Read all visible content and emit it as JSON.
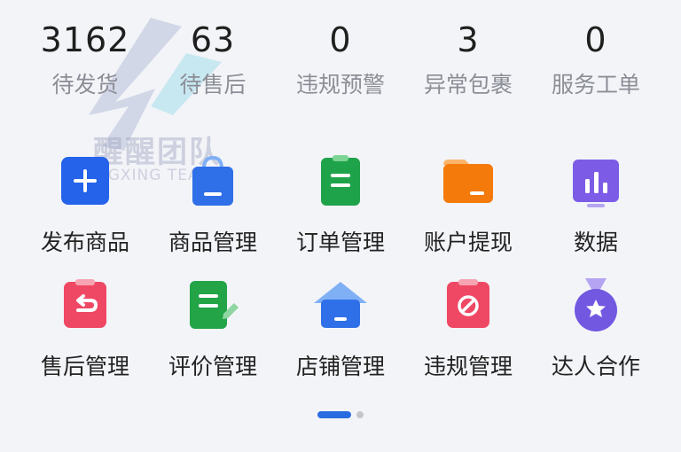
{
  "stats": [
    {
      "value": "3162",
      "label": "待发货"
    },
    {
      "value": "63",
      "label": "待售后"
    },
    {
      "value": "0",
      "label": "违规预警"
    },
    {
      "value": "3",
      "label": "异常包裹"
    },
    {
      "value": "0",
      "label": "服务工单"
    }
  ],
  "watermark": {
    "title": "醒醒团队",
    "subtitle": "NGXING TEAM"
  },
  "tools": [
    {
      "label": "发布商品",
      "icon": "add-icon",
      "color": "#2563eb"
    },
    {
      "label": "商品管理",
      "icon": "shopping-bag-icon",
      "color": "#2f6fe8"
    },
    {
      "label": "订单管理",
      "icon": "clipboard-list-icon",
      "color": "#1fa34a"
    },
    {
      "label": "账户提现",
      "icon": "wallet-folder-icon",
      "color": "#f57a0c"
    },
    {
      "label": "数据",
      "icon": "bar-chart-icon",
      "color": "#7c5ce6"
    },
    {
      "label": "售后管理",
      "icon": "return-clipboard-icon",
      "color": "#ef4864"
    },
    {
      "label": "评价管理",
      "icon": "edit-document-icon",
      "color": "#22a447"
    },
    {
      "label": "店铺管理",
      "icon": "store-house-icon",
      "color": "#2f6fe8"
    },
    {
      "label": "违规管理",
      "icon": "prohibited-clipboard-icon",
      "color": "#ef4864"
    },
    {
      "label": "达人合作",
      "icon": "star-medal-icon",
      "color": "#7257e0"
    }
  ],
  "pager": {
    "active_color": "#2b6be0"
  }
}
